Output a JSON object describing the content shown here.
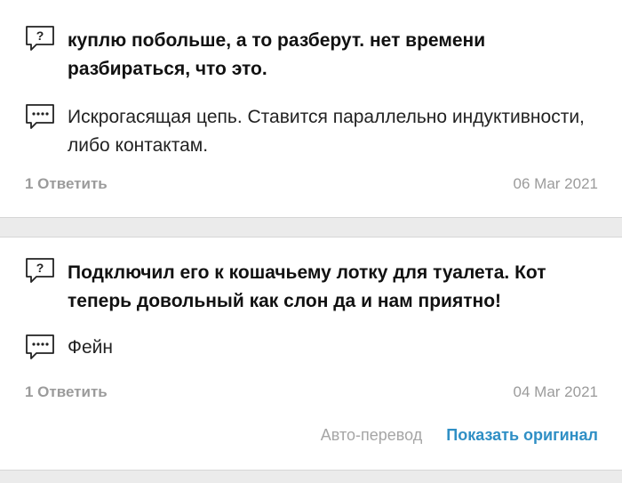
{
  "comments": [
    {
      "question": "куплю побольше, а то разберут. нет времени разбираться, что это.",
      "question_icon": "question-bubble-icon",
      "answer": "Искрогасящая цепь. Ставится параллельно индуктивности, либо контактам.",
      "answer_icon": "speech-bubble-dots-icon",
      "reply_label": "1 Ответить",
      "date": "06 Mar 2021"
    },
    {
      "question": "Подключил его к кошачьему лотку для туалета. Кот теперь довольный как слон да и нам приятно!",
      "question_icon": "question-bubble-icon",
      "answer": "Фейн",
      "answer_icon": "speech-bubble-dots-icon",
      "reply_label": "1 Ответить",
      "date": "04 Mar 2021",
      "auto_translate_label": "Авто-перевод",
      "show_original_label": "Показать оригинал"
    }
  ],
  "colors": {
    "link": "#2f8fc5",
    "muted": "#9b9b9b",
    "background": "#ebebeb"
  }
}
